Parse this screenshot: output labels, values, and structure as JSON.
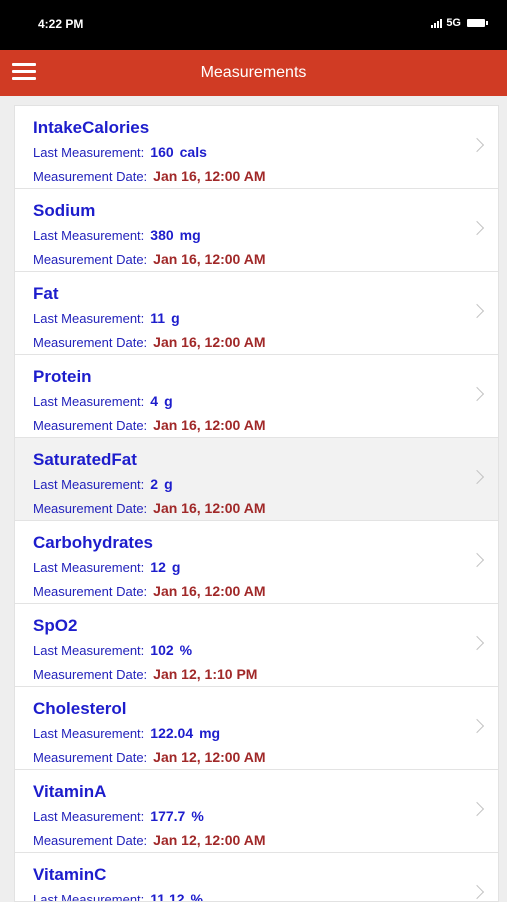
{
  "status_bar": {
    "time": "4:22 PM",
    "network": "5G"
  },
  "app_bar": {
    "title": "Measurements"
  },
  "labels": {
    "last_measurement": "Last Measurement:",
    "measurement_date": "Measurement Date:"
  },
  "items": [
    {
      "name": "IntakeCalories",
      "value": "160",
      "unit": "cals",
      "date": "Jan 16, 12:00 AM"
    },
    {
      "name": "Sodium",
      "value": "380",
      "unit": "mg",
      "date": "Jan 16, 12:00 AM"
    },
    {
      "name": "Fat",
      "value": "11",
      "unit": "g",
      "date": "Jan 16, 12:00 AM"
    },
    {
      "name": "Protein",
      "value": "4",
      "unit": "g",
      "date": "Jan 16, 12:00 AM"
    },
    {
      "name": "SaturatedFat",
      "value": "2",
      "unit": "g",
      "date": "Jan 16, 12:00 AM"
    },
    {
      "name": "Carbohydrates",
      "value": "12",
      "unit": "g",
      "date": "Jan 16, 12:00 AM"
    },
    {
      "name": "SpO2",
      "value": "102",
      "unit": "%",
      "date": "Jan 12, 1:10 PM"
    },
    {
      "name": "Cholesterol",
      "value": "122.04",
      "unit": "mg",
      "date": "Jan 12, 12:00 AM"
    },
    {
      "name": "VitaminA",
      "value": "177.7",
      "unit": "%",
      "date": "Jan 12, 12:00 AM"
    },
    {
      "name": "VitaminC",
      "value": "11.12",
      "unit": "%",
      "date": ""
    }
  ]
}
